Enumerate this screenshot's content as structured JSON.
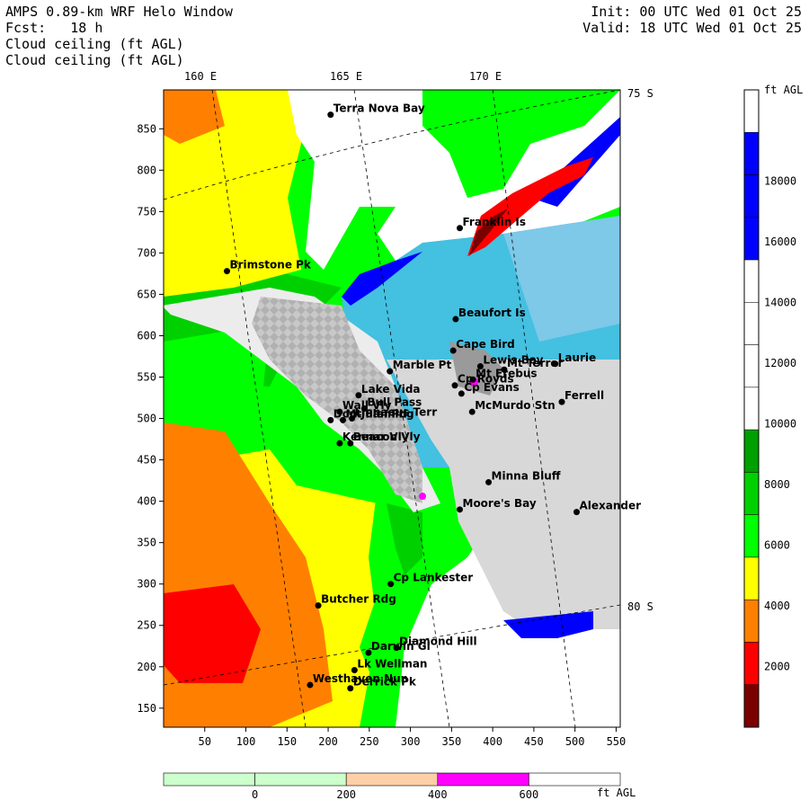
{
  "header": {
    "title": "AMPS 0.89-km WRF Helo Window",
    "forecast": "Fcst:   18 h",
    "field1": "Cloud ceiling (ft AGL)",
    "field2": "Cloud ceiling (ft AGL)",
    "init": "Init: 00 UTC Wed 01 Oct 25",
    "valid": "Valid: 18 UTC Wed 01 Oct 25"
  },
  "axes": {
    "x_ticks": [
      50,
      100,
      150,
      200,
      250,
      300,
      350,
      400,
      450,
      500,
      550
    ],
    "y_ticks": [
      150,
      200,
      250,
      300,
      350,
      400,
      450,
      500,
      550,
      600,
      650,
      700,
      750,
      800,
      850
    ],
    "x_range": [
      0,
      555
    ],
    "y_range": [
      127,
      897
    ],
    "lon_labels": [
      "160 E",
      "165 E",
      "170 E"
    ],
    "lat_labels": [
      "75 S",
      "80 S"
    ]
  },
  "legend_right": {
    "unit": "ft AGL",
    "labels": [
      "2000",
      "4000",
      "6000",
      "8000",
      "10000",
      "12000",
      "14000",
      "16000",
      "18000"
    ],
    "colors": [
      "#7a0000",
      "#ff0000",
      "#ff8000",
      "#ffff00",
      "#00ff00",
      "#00d000",
      "#00a000",
      "#ffffff",
      "#ffffff",
      "#ffffff",
      "#ffffff",
      "#0000ff",
      "#0000ff",
      "#0000ff",
      "#ffffff"
    ]
  },
  "legend_bottom": {
    "unit": "ft AGL",
    "labels": [
      "0",
      "200",
      "400",
      "600"
    ],
    "colors": [
      "#ccffcc",
      "#ccffcc",
      "#ffd0a8",
      "#ff00ff",
      "#ffffff"
    ]
  },
  "stations": [
    {
      "name": "Terra Nova Bay",
      "x": 203,
      "y": 867
    },
    {
      "name": "Franklin Is",
      "x": 360,
      "y": 730
    },
    {
      "name": "Brimstone Pk",
      "x": 77,
      "y": 678
    },
    {
      "name": "Beaufort Is",
      "x": 355,
      "y": 620
    },
    {
      "name": "Cape Bird",
      "x": 352,
      "y": 582
    },
    {
      "name": "Lewis Bay",
      "x": 385,
      "y": 563
    },
    {
      "name": "Laurie",
      "x": 476,
      "y": 566
    },
    {
      "name": "Mt Terror",
      "x": 414,
      "y": 559
    },
    {
      "name": "Marble Pt",
      "x": 275,
      "y": 557
    },
    {
      "name": "Mt Erebus",
      "x": 376,
      "y": 547
    },
    {
      "name": "Cp Royds",
      "x": 354,
      "y": 540
    },
    {
      "name": "Lake Vida",
      "x": 237,
      "y": 528
    },
    {
      "name": "Cp Evans",
      "x": 362,
      "y": 530
    },
    {
      "name": "Ferrell",
      "x": 484,
      "y": 520
    },
    {
      "name": "Wall Vly",
      "x": 214,
      "y": 508
    },
    {
      "name": "McMurdo Stn",
      "x": 375,
      "y": 508
    },
    {
      "name": "Bull Pass",
      "x": 244,
      "y": 512
    },
    {
      "name": "Don Juan Pd",
      "x": 203,
      "y": 498
    },
    {
      "name": "Mt Fleming",
      "x": 218,
      "y": 498
    },
    {
      "name": "Linnaeus Terr",
      "x": 229,
      "y": 500
    },
    {
      "name": "Kennar Vly",
      "x": 214,
      "y": 470
    },
    {
      "name": "Beacon Vly",
      "x": 227,
      "y": 470
    },
    {
      "name": "Minna Bluff",
      "x": 395,
      "y": 423
    },
    {
      "name": "Moore's Bay",
      "x": 360,
      "y": 390
    },
    {
      "name": "Alexander",
      "x": 502,
      "y": 387
    },
    {
      "name": "Cp Lankester",
      "x": 276,
      "y": 300
    },
    {
      "name": "Butcher Rdg",
      "x": 188,
      "y": 274
    },
    {
      "name": "Darwin Gl",
      "x": 249,
      "y": 217
    },
    {
      "name": "Diamond Hill",
      "x": 283,
      "y": 223
    },
    {
      "name": "Lk Wellman",
      "x": 232,
      "y": 196
    },
    {
      "name": "Westhaven Nun",
      "x": 178,
      "y": 178
    },
    {
      "name": "Derrick Pk",
      "x": 227,
      "y": 174
    }
  ]
}
